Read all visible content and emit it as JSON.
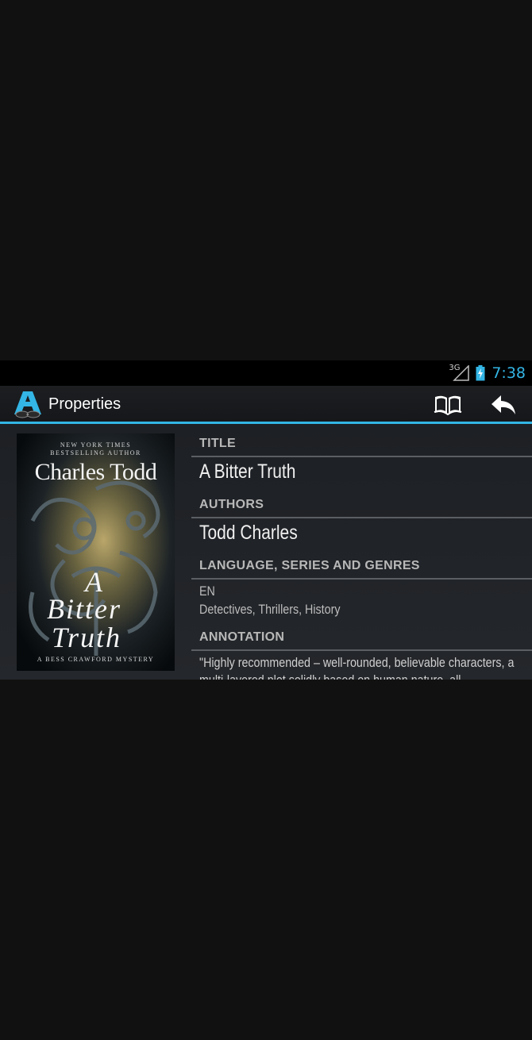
{
  "status_bar": {
    "network_label": "3G",
    "time": "7:38"
  },
  "action_bar": {
    "title": "Properties",
    "icons": [
      "app-logo-icon",
      "book-icon",
      "back-arrow-icon"
    ]
  },
  "cover": {
    "tagline_line1": "NEW YORK TIMES",
    "tagline_line2": "BESTSELLING AUTHOR",
    "author": "Charles Todd",
    "title_line1": "A",
    "title_line2": "Bitter",
    "title_line3": "Truth",
    "series": "A BESS CRAWFORD MYSTERY"
  },
  "properties": {
    "title_header": "TITLE",
    "title_value": "A Bitter Truth",
    "authors_header": "AUTHORS",
    "authors_value": "Todd Charles",
    "lang_header": "LANGUAGE, SERIES AND GENRES",
    "language": "EN",
    "genres": "Detectives, Thrillers, History",
    "annotation_header": "ANNOTATION",
    "annotation": "\"Highly recommended – well-rounded, believable characters, a multi-layered plot solidly based on human nature, all authentically"
  },
  "colors": {
    "accent": "#33b5e5",
    "background": "#111111"
  }
}
